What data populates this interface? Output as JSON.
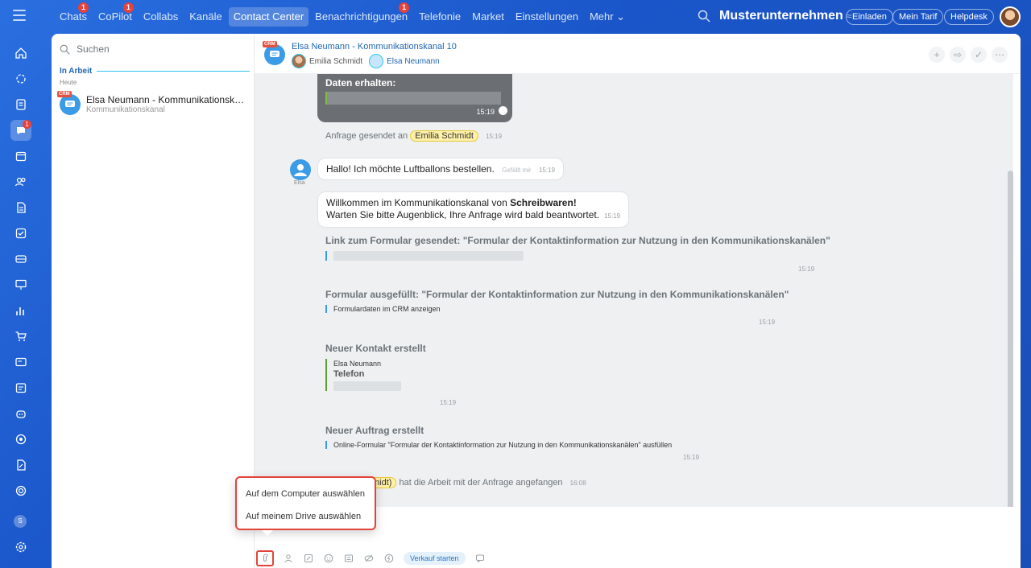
{
  "topbar": {
    "nav": [
      {
        "label": "Chats",
        "badge": "1"
      },
      {
        "label": "CoPilot",
        "badge": "1"
      },
      {
        "label": "Collabs",
        "badge": ""
      },
      {
        "label": "Kanäle",
        "badge": ""
      },
      {
        "label": "Contact Center",
        "badge": "",
        "active": true
      },
      {
        "label": "Benachrichtigungen",
        "badge": "1"
      },
      {
        "label": "Telefonie",
        "badge": ""
      },
      {
        "label": "Market",
        "badge": ""
      },
      {
        "label": "Einstellungen",
        "badge": ""
      },
      {
        "label": "Mehr ⌄",
        "badge": ""
      }
    ],
    "company": "Musterunternehmen",
    "company_icon": "≈",
    "invite": "Einladen",
    "tariff": "Mein Tarif",
    "helpdesk": "Helpdesk"
  },
  "rail": {
    "badge": "1",
    "user_initial": "S"
  },
  "sidebar": {
    "search_placeholder": "Suchen",
    "section": "In Arbeit",
    "day": "Heute",
    "conversation": {
      "crm": "CRM",
      "title": "Elsa Neumann - Kommunikationskan...",
      "subtitle": "Kommunikationskanal"
    }
  },
  "chat": {
    "crm": "CRM",
    "title": "Elsa Neumann - Kommunikationskanal 10",
    "member1": "Emilia Schmidt",
    "member2": "Elsa Neumann",
    "messages": {
      "data_received": "Daten erhalten:",
      "data_received_time": "15:19",
      "request_sent_prefix": "Anfrage gesendet an",
      "request_sent_to": "Emilia Schmidt",
      "request_sent_time": "15:19",
      "user_name": "Elsa",
      "hello": "Hallo! Ich möchte Luftballons bestellen.",
      "like": "Gefällt mir",
      "hello_time": "15:19",
      "welcome_prefix": "Willkommen im Kommunikationskanal von",
      "welcome_company": "Schreibwaren!",
      "welcome_line2": "Warten Sie bitte Augenblick, Ihre Anfrage wird bald beantwortet.",
      "welcome_time": "15:19",
      "form_link_title": "Link zum Formular gesendet: \"Formular der Kontaktinformation zur Nutzung in den Kommunikationskanälen\"",
      "form_link_time": "15:19",
      "form_filled_title": "Formular ausgefüllt: \"Formular der Kontaktinformation zur Nutzung in den Kommunikationskanälen\"",
      "form_filled_link": "Formulardaten im CRM anzeigen",
      "form_filled_time": "15:19",
      "contact_title": "Neuer Kontakt erstellt",
      "contact_name": "Elsa Neumann",
      "contact_phone_label": "Telefon",
      "contact_time": "15:19",
      "order_title": "Neuer Auftrag erstellt",
      "order_text": "Online-Formular \"Formular der Kontaktinformation zur Nutzung in den Kommunikationskanälen\" ausfüllen",
      "order_time": "15:19",
      "work_started_chip": "midt)",
      "work_started_text": "hat die Arbeit mit der Anfrage angefangen",
      "work_started_time": "16:08"
    },
    "sale_button": "Verkauf starten"
  },
  "popup": {
    "computer": "Auf dem Computer auswählen",
    "drive": "Auf meinem Drive auswählen"
  },
  "colors": {
    "accent": "#2067b0",
    "highlight": "#e2443b",
    "badge": "#e6413a"
  }
}
